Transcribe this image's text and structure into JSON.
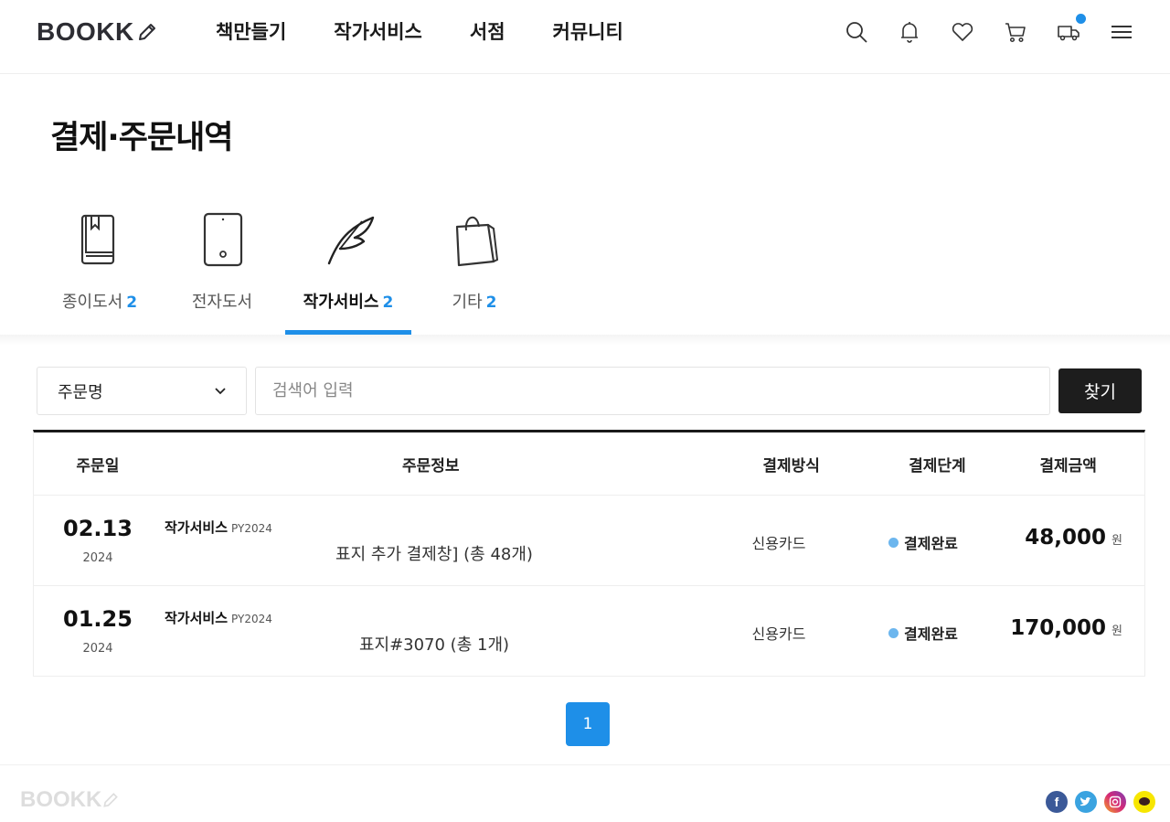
{
  "header": {
    "logo": "BOOKK",
    "nav": [
      "책만들기",
      "작가서비스",
      "서점",
      "커뮤니티"
    ],
    "icons": [
      "search-icon",
      "bell-icon",
      "heart-icon",
      "cart-icon",
      "truck-icon",
      "menu-icon"
    ]
  },
  "page": {
    "title": "결제·주문내역"
  },
  "tabs": [
    {
      "label": "종이도서",
      "count": "2",
      "icon": "book-icon",
      "active": false
    },
    {
      "label": "전자도서",
      "count": "2",
      "icon": "tablet-icon",
      "active": false
    },
    {
      "label": "작가서비스",
      "count": "2",
      "icon": "quill-icon",
      "active": true
    },
    {
      "label": "기타",
      "count": "2",
      "icon": "shopping-bag-icon",
      "active": false
    }
  ],
  "search": {
    "select_value": "주문명",
    "placeholder": "검색어 입력",
    "button": "찾기"
  },
  "table": {
    "headers": [
      "주문일",
      "주문정보",
      "결제방식",
      "결제단계",
      "결제금액"
    ],
    "rows": [
      {
        "date": "02.13",
        "year": "2024",
        "category": "작가서비스",
        "code": "PY2024",
        "title": "표지 추가 결제창] (총 48개)",
        "payment": "신용카드",
        "stage": "결제완료",
        "amount": "48,000",
        "unit": "원"
      },
      {
        "date": "01.25",
        "year": "2024",
        "category": "작가서비스",
        "code": "PY2024",
        "title": "표지#3070 (총 1개)",
        "payment": "신용카드",
        "stage": "결제완료",
        "amount": "170,000",
        "unit": "원"
      }
    ]
  },
  "pagination": {
    "current": "1"
  },
  "footer": {
    "logo": "BOOKK",
    "social": [
      "facebook-icon",
      "twitter-icon",
      "instagram-icon",
      "kakaotalk-icon"
    ]
  },
  "colors": {
    "accent": "#1e8fe8",
    "dark": "#1d1d1d",
    "status_dot": "#6cb6ee"
  }
}
